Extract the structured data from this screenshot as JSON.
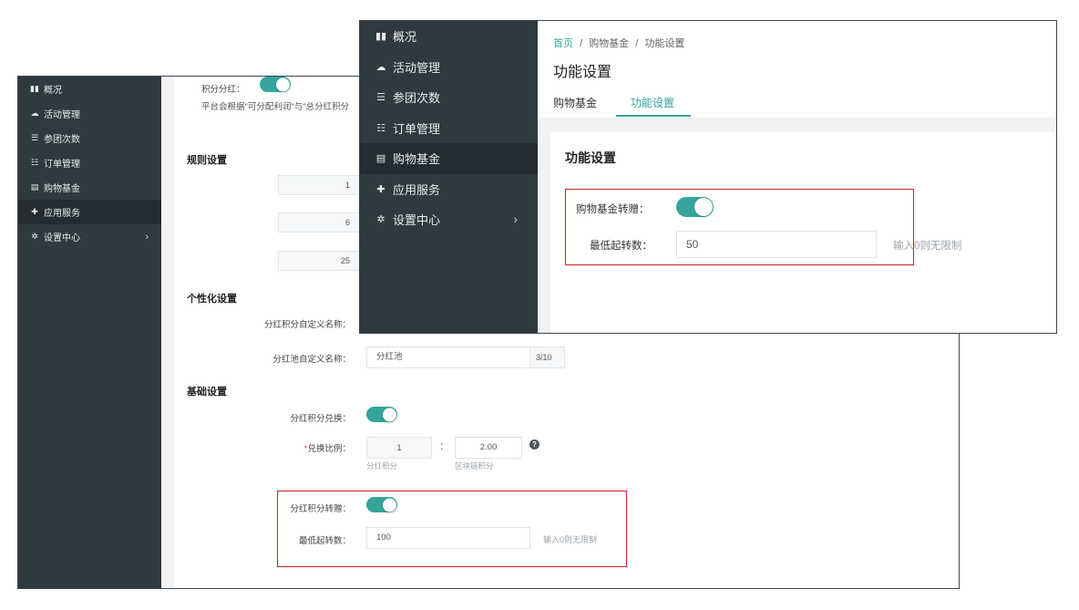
{
  "nav_items": [
    {
      "label": "概况",
      "icon": "bar-chart-icon"
    },
    {
      "label": "活动管理",
      "icon": "cloud-icon"
    },
    {
      "label": "参团次数",
      "icon": "list-icon"
    },
    {
      "label": "订单管理",
      "icon": "list-lines-icon"
    },
    {
      "label": "购物基金",
      "icon": "card-icon"
    },
    {
      "label": "应用服务",
      "icon": "puzzle-icon"
    },
    {
      "label": "设置中心",
      "icon": "gear-icon"
    }
  ],
  "chevron": "›",
  "back": {
    "dividend_toggle_label": "积分分红：",
    "dividend_desc": "平台会根据\"可分配利润\"与\"总分红积分",
    "rules_title": "规则设置",
    "rule_values": [
      "1",
      "6",
      "25"
    ],
    "personal_title": "个性化设置",
    "points_name_label": "分红积分自定义名称：",
    "pool_name_label": "分红池自定义名称：",
    "pool_name_value": "分红池",
    "pool_name_count": "3/10",
    "basic_title": "基础设置",
    "exchange_label": "分红积分兑换：",
    "ratio_required_mark": "*",
    "ratio_label": "兑换比例：",
    "ratio_left": "1",
    "ratio_colon": ":",
    "ratio_right": "2.00",
    "ratio_left_unit": "分红积分",
    "ratio_right_unit": "区块链积分",
    "help_icon_glyph": "?",
    "transfer_label": "分红积分转赠：",
    "min_label": "最低起转数：",
    "min_value": "100",
    "min_hint": "输入0则无限制"
  },
  "front": {
    "breadcrumb": {
      "home": "首页",
      "sep": "/",
      "mid": "购物基金",
      "current": "功能设置"
    },
    "page_title": "功能设置",
    "tabs": [
      "购物基金",
      "功能设置"
    ],
    "card_title": "功能设置",
    "transfer_label": "购物基金转赠：",
    "min_label": "最低起转数：",
    "min_value": "50",
    "min_hint": "输入0则无限制"
  },
  "colors": {
    "accent": "#36a49b",
    "sidebar": "#2f3a3e",
    "highlight": "#c8202a"
  }
}
